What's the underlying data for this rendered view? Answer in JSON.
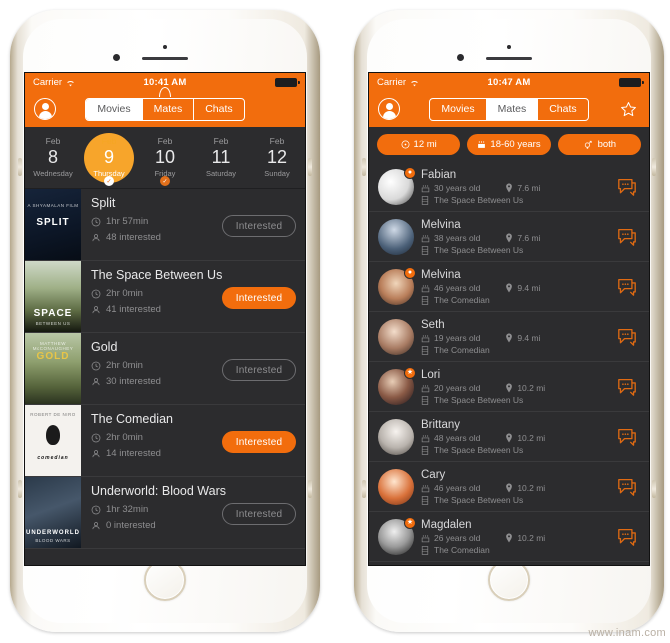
{
  "watermark": "www.inam.com",
  "left_phone": {
    "status": {
      "carrier": "Carrier",
      "time": "10:41 AM",
      "wifi_icon": "wifi-icon",
      "battery_icon": "battery-full-icon"
    },
    "nav": {
      "avatar_icon": "profile-avatar-icon",
      "tabs": [
        {
          "label": "Movies",
          "active": true
        },
        {
          "label": "Mates",
          "active": false
        },
        {
          "label": "Chats",
          "active": false
        }
      ]
    },
    "dates": [
      {
        "month": "Feb",
        "day": "8",
        "weekday": "Wednesday",
        "selected": false,
        "marker": "none"
      },
      {
        "month": "Feb",
        "day": "9",
        "weekday": "Thursday",
        "selected": true,
        "marker": "white-check"
      },
      {
        "month": "Feb",
        "day": "10",
        "weekday": "Friday",
        "selected": false,
        "marker": "orange-check"
      },
      {
        "month": "Feb",
        "day": "11",
        "weekday": "Saturday",
        "selected": false,
        "marker": "none"
      },
      {
        "month": "Feb",
        "day": "12",
        "weekday": "Sunday",
        "selected": false,
        "marker": "none"
      }
    ],
    "movies": [
      {
        "title": "Split",
        "duration": "1hr 57min",
        "interested_count": "48 interested",
        "button": "Interested",
        "button_state": "off",
        "poster": "SPLIT",
        "poster_caption": "A SHYAMALAN FILM",
        "poster_class": "p-split"
      },
      {
        "title": "The Space Between Us",
        "duration": "2hr 0min",
        "interested_count": "41 interested",
        "button": "Interested",
        "button_state": "on",
        "poster": "SPACE",
        "poster_caption": "BETWEEN US",
        "poster_class": "p-space"
      },
      {
        "title": "Gold",
        "duration": "2hr 0min",
        "interested_count": "30 interested",
        "button": "Interested",
        "button_state": "off",
        "poster": "GOLD",
        "poster_caption": "MATTHEW McCONAUGHEY",
        "poster_class": "p-gold"
      },
      {
        "title": "The Comedian",
        "duration": "2hr 0min",
        "interested_count": "14 interested",
        "button": "Interested",
        "button_state": "on",
        "poster": "comedian",
        "poster_caption": "ROBERT DE NIRO",
        "poster_class": "p-comed"
      },
      {
        "title": "Underworld: Blood Wars",
        "duration": "1hr 32min",
        "interested_count": "0 interested",
        "button": "Interested",
        "button_state": "off",
        "poster": "UNDERWORLD",
        "poster_caption": "BLOOD WARS",
        "poster_class": "p-under"
      }
    ],
    "icons": {
      "clock": "clock-icon",
      "people": "person-count-icon"
    }
  },
  "right_phone": {
    "status": {
      "carrier": "Carrier",
      "time": "10:47 AM",
      "wifi_icon": "wifi-icon",
      "battery_icon": "battery-full-icon"
    },
    "nav": {
      "avatar_icon": "profile-avatar-icon",
      "star_icon": "star-outline-icon",
      "tabs": [
        {
          "label": "Movies",
          "active": false
        },
        {
          "label": "Mates",
          "active": true
        },
        {
          "label": "Chats",
          "active": false
        }
      ]
    },
    "filters": [
      {
        "label": "12 mi",
        "icon": "distance-icon"
      },
      {
        "label": "18-60 years",
        "icon": "age-icon"
      },
      {
        "label": "both",
        "icon": "gender-icon"
      }
    ],
    "mates": [
      {
        "name": "Fabian",
        "age": "30 years old",
        "distance": "7.6 mi",
        "movie": "The Space Between Us",
        "badge": "dot",
        "avatar": "avatar-fabian"
      },
      {
        "name": "Melvina",
        "age": "38 years old",
        "distance": "7.6 mi",
        "movie": "The Space Between Us",
        "badge": "none",
        "avatar": "avatar-melvina1"
      },
      {
        "name": "Melvina",
        "age": "46 years old",
        "distance": "9.4 mi",
        "movie": "The Comedian",
        "badge": "dot",
        "avatar": "avatar-melvina2"
      },
      {
        "name": "Seth",
        "age": "19 years old",
        "distance": "9.4 mi",
        "movie": "The Comedian",
        "badge": "none",
        "avatar": "avatar-seth"
      },
      {
        "name": "Lori",
        "age": "20 years old",
        "distance": "10.2 mi",
        "movie": "The Space Between Us",
        "badge": "star",
        "avatar": "avatar-lori"
      },
      {
        "name": "Brittany",
        "age": "48 years old",
        "distance": "10.2 mi",
        "movie": "The Space Between Us",
        "badge": "none",
        "avatar": "avatar-brittany"
      },
      {
        "name": "Cary",
        "age": "46 years old",
        "distance": "10.2 mi",
        "movie": "The Space Between Us",
        "badge": "none",
        "avatar": "avatar-cary"
      },
      {
        "name": "Magdalen",
        "age": "26 years old",
        "distance": "10.2 mi",
        "movie": "The Comedian",
        "badge": "star",
        "avatar": "avatar-magdalen"
      }
    ],
    "icons": {
      "age": "cake-icon",
      "pin": "location-pin-icon",
      "movie": "film-icon",
      "chat": "chat-bubble-icon"
    }
  },
  "colors": {
    "accent": "#f26d0d",
    "selected_day": "#f7a52b",
    "screen_bg": "#2c2c2e",
    "row_divider": "#3a3a3c",
    "muted_text": "#8e8e90"
  }
}
